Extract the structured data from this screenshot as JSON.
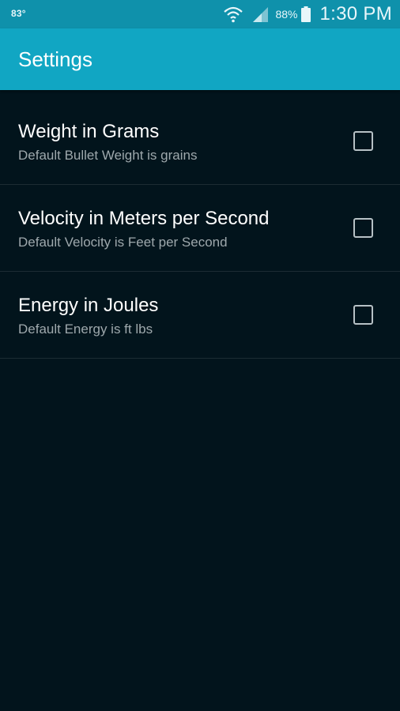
{
  "status_bar": {
    "temperature": "83°",
    "battery_percent": "88%",
    "time": "1:30 PM",
    "icons": [
      "wifi-icon",
      "signal-icon",
      "battery-icon"
    ]
  },
  "app_bar": {
    "title": "Settings"
  },
  "settings": [
    {
      "title": "Weight in Grams",
      "summary": "Default Bullet Weight is grains",
      "checked": false
    },
    {
      "title": "Velocity in Meters per Second",
      "summary": "Default Velocity is Feet per Second",
      "checked": false
    },
    {
      "title": "Energy in Joules",
      "summary": "Default Energy is ft lbs",
      "checked": false
    }
  ],
  "colors": {
    "status_bar": "#0f91ab",
    "app_bar": "#11a6c3",
    "background": "#02141c",
    "divider": "#1c2c33"
  }
}
